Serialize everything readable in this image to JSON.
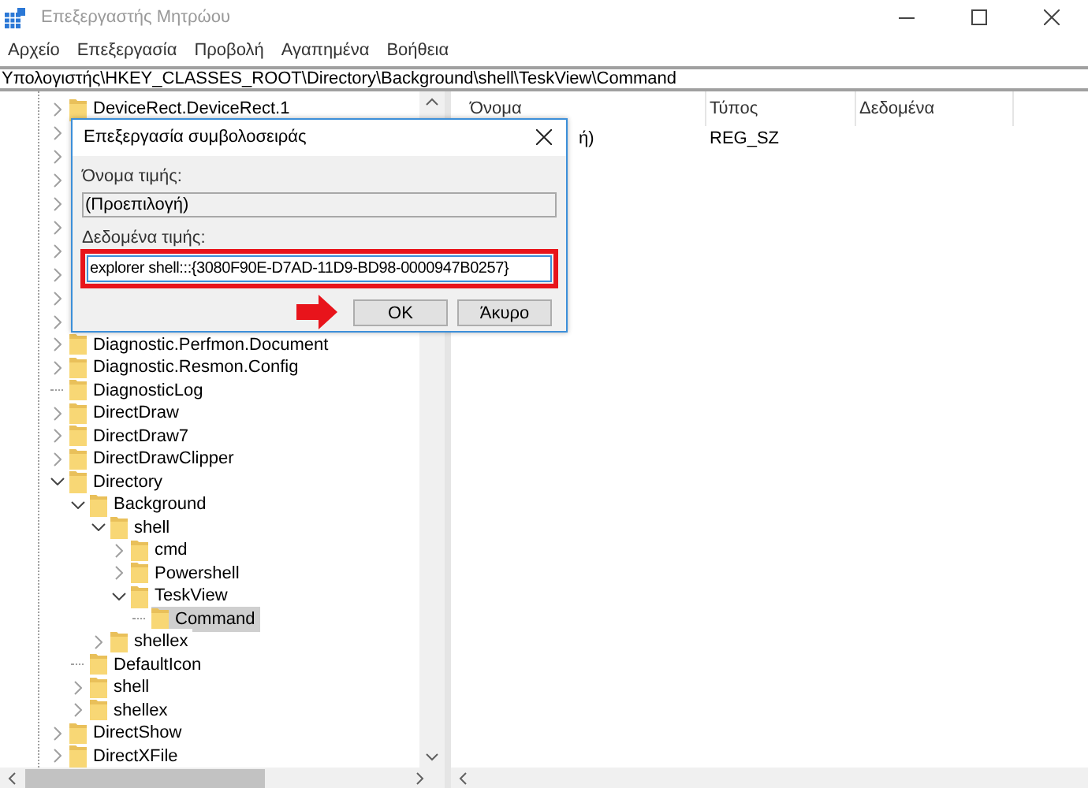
{
  "window": {
    "title": "Επεξεργαστής Μητρώου"
  },
  "menu": [
    "Αρχείο",
    "Επεξεργασία",
    "Προβολή",
    "Αγαπημένα",
    "Βοήθεια"
  ],
  "address": "Υπολογιστής\\HKEY_CLASSES_ROOT\\Directory\\Background\\shell\\TeskView\\Command",
  "tree": [
    {
      "label": "DeviceRect.DeviceRect.1",
      "kind": "branch",
      "expanded": false,
      "selected": false
    },
    {
      "kind": "branch",
      "expanded": false
    },
    {
      "kind": "branch",
      "expanded": false
    },
    {
      "kind": "branch",
      "expanded": false
    },
    {
      "kind": "branch",
      "expanded": false
    },
    {
      "kind": "branch",
      "expanded": false
    },
    {
      "kind": "branch",
      "expanded": false
    },
    {
      "kind": "branch",
      "expanded": false
    },
    {
      "kind": "branch",
      "expanded": false
    },
    {
      "kind": "branch",
      "expanded": false
    },
    {
      "label": "Diagnostic.Perfmon.Document",
      "kind": "branch",
      "expanded": false,
      "selected": false
    },
    {
      "label": "Diagnostic.Resmon.Config",
      "kind": "branch",
      "expanded": false,
      "selected": false
    },
    {
      "label": "DiagnosticLog",
      "kind": "leaf",
      "selected": false
    },
    {
      "label": "DirectDraw",
      "kind": "branch",
      "expanded": false,
      "selected": false
    },
    {
      "label": "DirectDraw7",
      "kind": "branch",
      "expanded": false,
      "selected": false
    },
    {
      "label": "DirectDrawClipper",
      "kind": "branch",
      "expanded": false,
      "selected": false
    },
    {
      "label": "Directory",
      "kind": "branch",
      "expanded": true,
      "selected": false,
      "children": [
        {
          "label": "Background",
          "kind": "branch",
          "expanded": true,
          "selected": false,
          "children": [
            {
              "label": "shell",
              "kind": "branch",
              "expanded": true,
              "selected": false,
              "children": [
                {
                  "label": "cmd",
                  "kind": "branch",
                  "expanded": false,
                  "selected": false
                },
                {
                  "label": "Powershell",
                  "kind": "branch",
                  "expanded": false,
                  "selected": false
                },
                {
                  "label": "TeskView",
                  "kind": "branch",
                  "expanded": true,
                  "selected": false,
                  "children": [
                    {
                      "label": "Command",
                      "kind": "leaf",
                      "selected": true
                    }
                  ]
                }
              ]
            },
            {
              "label": "shellex",
              "kind": "branch",
              "expanded": false,
              "selected": false
            }
          ]
        },
        {
          "label": "DefaultIcon",
          "kind": "leaf",
          "selected": false
        },
        {
          "label": "shell",
          "kind": "branch",
          "expanded": false,
          "selected": false
        },
        {
          "label": "shellex",
          "kind": "branch",
          "expanded": false,
          "selected": false
        }
      ]
    },
    {
      "label": "DirectShow",
      "kind": "branch",
      "expanded": false,
      "selected": false
    },
    {
      "label": "DirectXFile",
      "kind": "branch",
      "expanded": false,
      "selected": false
    }
  ],
  "list": {
    "columns": [
      "Όνομα",
      "Τύπος",
      "Δεδομένα"
    ],
    "rows": [
      {
        "name": "ή)",
        "type": "REG_SZ"
      }
    ]
  },
  "dialog": {
    "title": "Επεξεργασία συμβολοσειράς",
    "name_label": "Όνομα τιμής:",
    "name_value": "(Προεπιλογή)",
    "data_label": "Δεδομένα τιμής:",
    "data_value": "explorer shell:::{3080F90E-D7AD-11D9-BD98-0000947B0257}",
    "buttons": [
      "OK",
      "Άκυρο"
    ]
  }
}
